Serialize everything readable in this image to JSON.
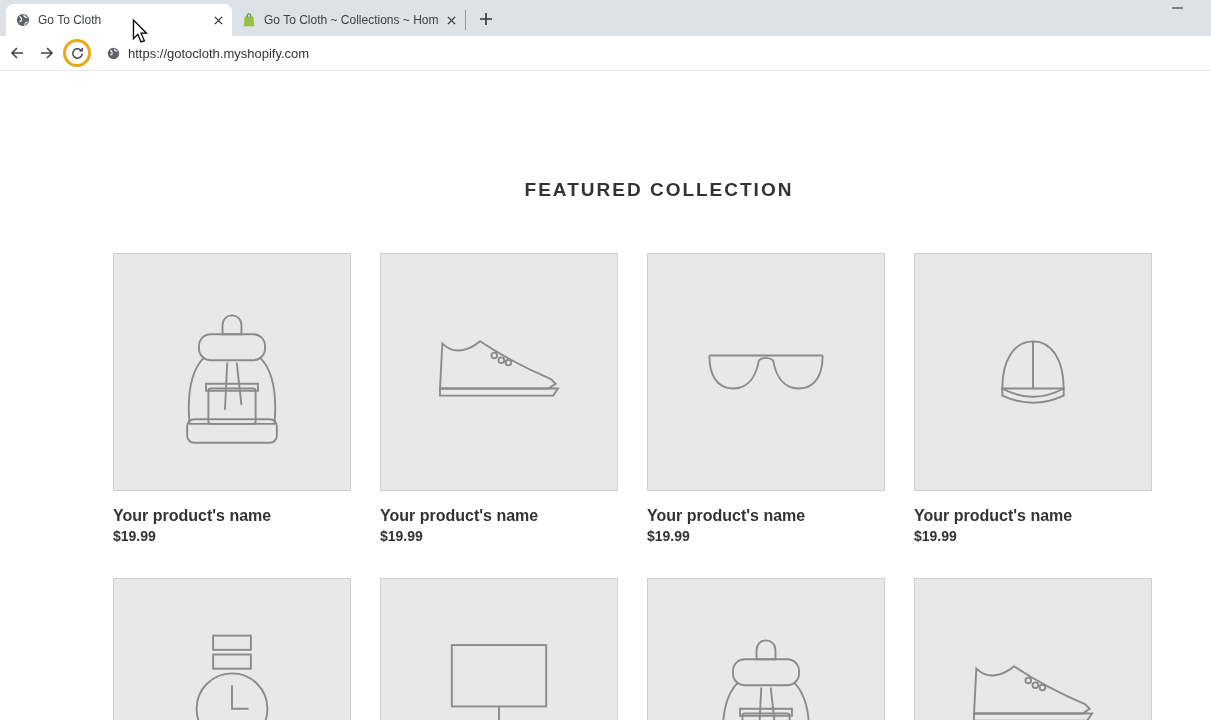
{
  "browser": {
    "tabs": [
      {
        "title": "Go To Cloth",
        "kind": "globe",
        "selected": true
      },
      {
        "title": "Go To Cloth ~ Collections ~ Hom",
        "kind": "bag",
        "selected": false
      }
    ],
    "reload_highlighted": true,
    "url": "https://gotocloth.myshopify.com"
  },
  "page": {
    "heading": "FEATURED COLLECTION",
    "products": [
      {
        "kind": "backpack",
        "name": "Your product's name",
        "price": "$19.99"
      },
      {
        "kind": "shoe",
        "name": "Your product's name",
        "price": "$19.99"
      },
      {
        "kind": "glasses",
        "name": "Your product's name",
        "price": "$19.99"
      },
      {
        "kind": "cap",
        "name": "Your product's name",
        "price": "$19.99"
      },
      {
        "kind": "watch"
      },
      {
        "kind": "easel"
      },
      {
        "kind": "backpack"
      },
      {
        "kind": "shoe"
      }
    ]
  }
}
